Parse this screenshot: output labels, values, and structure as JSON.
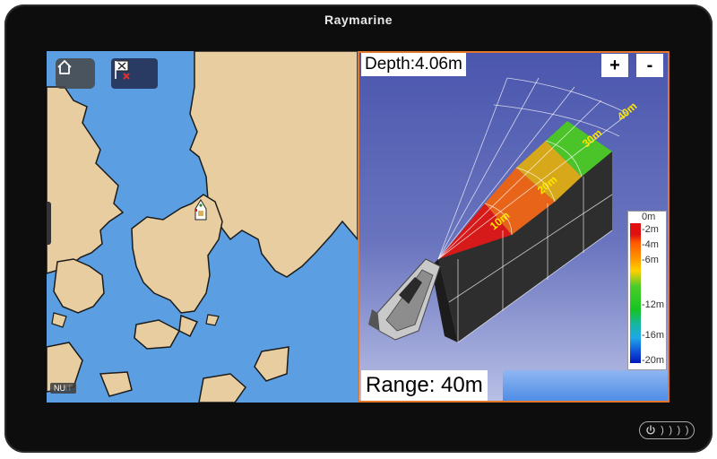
{
  "device": {
    "brand": "Raymarine"
  },
  "chart_pane": {
    "home_icon": "home-icon",
    "mob_icon": "mob-flag-icon",
    "badge_text": "NU",
    "badge_suffix": "iT",
    "colors": {
      "water": "#5b9fe2",
      "land": "#e8cda0",
      "outline": "#1b1b1b"
    }
  },
  "sonar_pane": {
    "depth_label": "Depth:4.06m",
    "zoom_in_label": "+",
    "zoom_out_label": "-",
    "range_label": "Range: 40m",
    "fan_labels": [
      "10m",
      "20m",
      "30m",
      "40m"
    ],
    "legend": {
      "labels": [
        "0m",
        "-2m",
        "-4m",
        "-6m",
        "-12m",
        "-16m",
        "-20m"
      ]
    },
    "colors": {
      "border": "#e2772b",
      "label": "#ffe600"
    }
  },
  "hardware": {
    "power_icon": "power-icon"
  }
}
